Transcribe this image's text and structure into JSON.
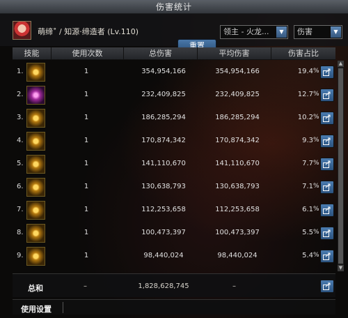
{
  "window": {
    "title": "伤害统计"
  },
  "header": {
    "player": "萌缔˚ / 知源·缔造者 (Lv.110)",
    "reset_label": "重置",
    "target_select": "领主 - 火龙...",
    "metric_select": "伤害"
  },
  "columns": [
    "技能",
    "使用次数",
    "总伤害",
    "平均伤害",
    "伤害占比"
  ],
  "rows": [
    {
      "rank": "1.",
      "count": "1",
      "total": "354,954,166",
      "avg": "354,954,166",
      "pct": "19.4",
      "icon": "skill-gold-claw-icon"
    },
    {
      "rank": "2.",
      "count": "1",
      "total": "232,409,825",
      "avg": "232,409,825",
      "pct": "12.7",
      "icon": "skill-purple-burst-icon"
    },
    {
      "rank": "3.",
      "count": "1",
      "total": "186,285,294",
      "avg": "186,285,294",
      "pct": "10.2",
      "icon": "skill-gold-wing-icon"
    },
    {
      "rank": "4.",
      "count": "1",
      "total": "170,874,342",
      "avg": "170,874,342",
      "pct": "9.3",
      "icon": "skill-gold-swirl-icon"
    },
    {
      "rank": "5.",
      "count": "1",
      "total": "141,110,670",
      "avg": "141,110,670",
      "pct": "7.7",
      "icon": "skill-gold-orb-icon"
    },
    {
      "rank": "6.",
      "count": "1",
      "total": "130,638,793",
      "avg": "130,638,793",
      "pct": "7.1",
      "icon": "skill-gold-flame-icon"
    },
    {
      "rank": "7.",
      "count": "1",
      "total": "112,253,658",
      "avg": "112,253,658",
      "pct": "6.1",
      "icon": "skill-gold-horn-icon"
    },
    {
      "rank": "8.",
      "count": "1",
      "total": "100,473,397",
      "avg": "100,473,397",
      "pct": "5.5",
      "icon": "skill-gold-blaze-icon"
    },
    {
      "rank": "9.",
      "count": "1",
      "total": "98,440,024",
      "avg": "98,440,024",
      "pct": "5.4",
      "icon": "skill-gold-star-icon"
    }
  ],
  "pct_symbol": "%",
  "total": {
    "label": "总和",
    "count": "–",
    "sum": "1,828,628,745",
    "avg": "–"
  },
  "footer": {
    "settings_label": "使用设置"
  },
  "colors": {
    "accent": "#3d6a9c",
    "title_bar": "#4a4e54",
    "gold": "#d4a020"
  }
}
